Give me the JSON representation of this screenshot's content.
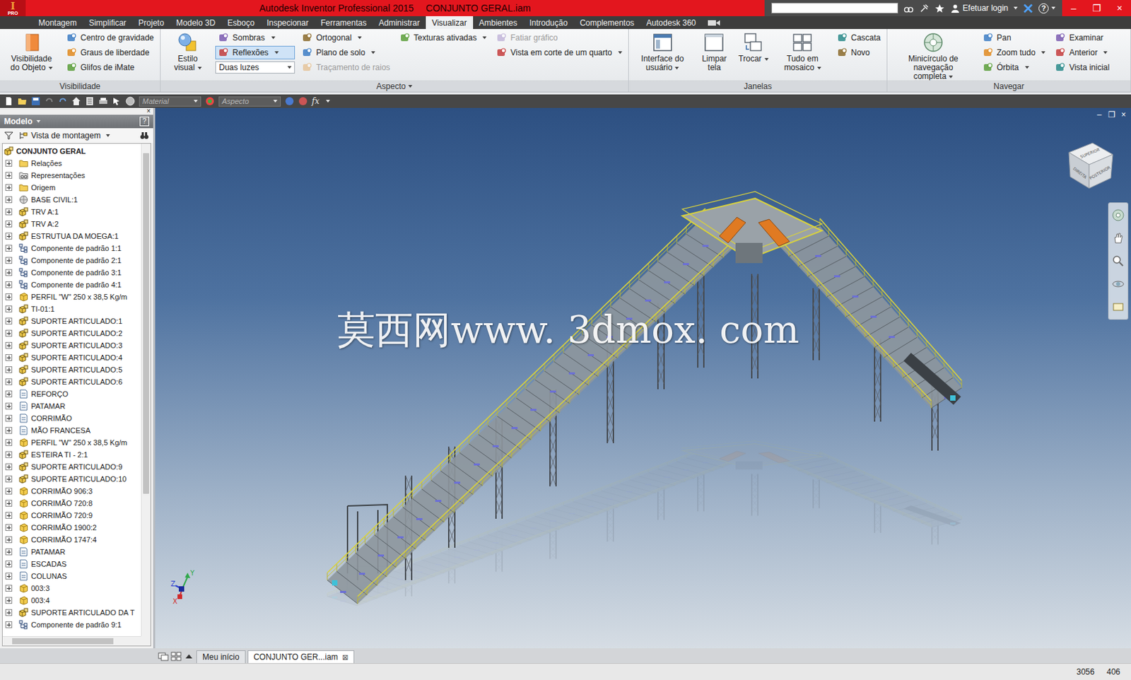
{
  "titlebar": {
    "logo_letter": "I",
    "badge": "PRO",
    "app": "Autodesk Inventor Professional 2015",
    "document": "CONJUNTO GERAL.iam",
    "search": "",
    "login": "Efetuar login",
    "help": "?",
    "controls": [
      "–",
      "❐",
      "×"
    ]
  },
  "tabs": [
    {
      "label": "Montagem",
      "selected": false
    },
    {
      "label": "Simplificar",
      "selected": false
    },
    {
      "label": "Projeto",
      "selected": false
    },
    {
      "label": "Modelo 3D",
      "selected": false
    },
    {
      "label": "Esboço",
      "selected": false
    },
    {
      "label": "Inspecionar",
      "selected": false
    },
    {
      "label": "Ferramentas",
      "selected": false
    },
    {
      "label": "Administrar",
      "selected": false
    },
    {
      "label": "Visualizar",
      "selected": true
    },
    {
      "label": "Ambientes",
      "selected": false
    },
    {
      "label": "Introdução",
      "selected": false
    },
    {
      "label": "Complementos",
      "selected": false
    },
    {
      "label": "Autodesk 360",
      "selected": false
    }
  ],
  "ribbon": {
    "panels": [
      {
        "label": "Visibilidade",
        "dropdown": false,
        "groups": [
          {
            "kind": "big",
            "button": {
              "label": "Visibilidade do Objeto",
              "dropdown": true,
              "selected": false,
              "disabled": false
            }
          },
          {
            "kind": "column",
            "buttons": [
              {
                "label": "Centro de gravidade",
                "kind": "button",
                "dropdown": false,
                "selected": false,
                "disabled": false
              },
              {
                "label": "Graus de liberdade",
                "kind": "button",
                "dropdown": false,
                "selected": false,
                "disabled": false
              },
              {
                "label": "Glifos de iMate",
                "kind": "button",
                "dropdown": false,
                "selected": false,
                "disabled": false
              }
            ]
          }
        ]
      },
      {
        "label": "Aspecto",
        "dropdown": true,
        "groups": [
          {
            "kind": "big",
            "button": {
              "label": "Estilo visual",
              "dropdown": true,
              "selected": false,
              "disabled": false
            }
          },
          {
            "kind": "column",
            "buttons": [
              {
                "label": "Sombras",
                "kind": "button",
                "dropdown": true,
                "selected": false,
                "disabled": false
              },
              {
                "label": "Reflexões",
                "kind": "button",
                "dropdown": true,
                "selected": true,
                "disabled": false
              },
              {
                "label": "Duas luzes",
                "kind": "combo",
                "dropdown": true,
                "selected": false,
                "disabled": false
              }
            ]
          },
          {
            "kind": "column",
            "buttons": [
              {
                "label": "Ortogonal",
                "kind": "button",
                "dropdown": true,
                "selected": false,
                "disabled": false
              },
              {
                "label": "Plano de solo",
                "kind": "button",
                "dropdown": true,
                "selected": false,
                "disabled": false
              },
              {
                "label": "Traçamento de raios",
                "kind": "button",
                "dropdown": false,
                "selected": false,
                "disabled": true
              }
            ]
          },
          {
            "kind": "column",
            "buttons": [
              {
                "label": "Texturas ativadas",
                "kind": "button",
                "dropdown": true,
                "selected": false,
                "disabled": false
              }
            ]
          },
          {
            "kind": "column",
            "buttons": [
              {
                "label": "Fatiar gráfico",
                "kind": "button",
                "dropdown": false,
                "selected": false,
                "disabled": true
              },
              {
                "label": "Vista em corte de um quarto",
                "kind": "button",
                "dropdown": true,
                "selected": false,
                "disabled": false
              }
            ]
          }
        ]
      },
      {
        "label": "Janelas",
        "dropdown": false,
        "groups": [
          {
            "kind": "big",
            "button": {
              "label": "Interface do usuário",
              "dropdown": true,
              "selected": false,
              "disabled": false
            }
          },
          {
            "kind": "big",
            "button": {
              "label": "Limpar tela",
              "dropdown": false,
              "selected": false,
              "disabled": false
            }
          },
          {
            "kind": "big",
            "button": {
              "label": "Trocar",
              "dropdown": true,
              "selected": false,
              "disabled": false
            }
          },
          {
            "kind": "big",
            "button": {
              "label": "Tudo em mosaico",
              "dropdown": true,
              "selected": false,
              "disabled": false
            }
          },
          {
            "kind": "column",
            "buttons": [
              {
                "label": "Cascata",
                "kind": "button",
                "dropdown": false,
                "selected": false,
                "disabled": false
              },
              {
                "label": "Novo",
                "kind": "button",
                "dropdown": false,
                "selected": false,
                "disabled": false
              }
            ]
          }
        ]
      },
      {
        "label": "Navegar",
        "dropdown": false,
        "groups": [
          {
            "kind": "big",
            "button": {
              "label": "Minicírculo de navegação completa",
              "dropdown": true,
              "selected": false,
              "disabled": false
            }
          },
          {
            "kind": "column",
            "buttons": [
              {
                "label": "Pan",
                "kind": "button",
                "dropdown": false,
                "selected": false,
                "disabled": false
              },
              {
                "label": "Zoom tudo",
                "kind": "button",
                "dropdown": true,
                "selected": false,
                "disabled": false
              },
              {
                "label": "Órbita",
                "kind": "button",
                "dropdown": true,
                "selected": false,
                "disabled": false
              }
            ]
          },
          {
            "kind": "column",
            "buttons": [
              {
                "label": "Examinar",
                "kind": "button",
                "dropdown": false,
                "selected": false,
                "disabled": false
              },
              {
                "label": "Anterior",
                "kind": "button",
                "dropdown": true,
                "selected": false,
                "disabled": false
              },
              {
                "label": "Vista inicial",
                "kind": "button",
                "dropdown": false,
                "selected": false,
                "disabled": false
              }
            ]
          }
        ]
      }
    ]
  },
  "quick_access": {
    "material": "Material",
    "appearance": "Aspecto",
    "fx": "fx",
    "disabled": true
  },
  "browser": {
    "title": "Modelo",
    "help": "?",
    "close": "×",
    "view": "Vista de montagem",
    "items": [
      {
        "label": "CONJUNTO GERAL",
        "kind": "root",
        "expanded": true,
        "selected": false
      },
      {
        "label": "Relações",
        "kind": "folder",
        "expanded": false,
        "selected": false
      },
      {
        "label": "Representações",
        "kind": "representations",
        "expanded": false,
        "selected": false
      },
      {
        "label": "Origem",
        "kind": "folder",
        "expanded": false,
        "selected": false
      },
      {
        "label": "BASE CIVIL:1",
        "kind": "civil",
        "expanded": false,
        "selected": false
      },
      {
        "label": "TRV A:1",
        "kind": "assembly",
        "expanded": false,
        "selected": false
      },
      {
        "label": "TRV A:2",
        "kind": "assembly",
        "expanded": false,
        "selected": false
      },
      {
        "label": "ESTRUTUA DA MOEGA:1",
        "kind": "assembly",
        "expanded": false,
        "selected": false
      },
      {
        "label": "Componente de padrão 1:1",
        "kind": "pattern",
        "expanded": false,
        "selected": false
      },
      {
        "label": "Componente de padrão 2:1",
        "kind": "pattern",
        "expanded": false,
        "selected": false
      },
      {
        "label": "Componente de padrão 3:1",
        "kind": "pattern",
        "expanded": false,
        "selected": false
      },
      {
        "label": "Componente de padrão 4:1",
        "kind": "pattern",
        "expanded": false,
        "selected": false
      },
      {
        "label": "PERFIL \"W\" 250 x 38,5 Kg/m",
        "kind": "part",
        "expanded": false,
        "selected": false
      },
      {
        "label": "TI-01:1",
        "kind": "assembly",
        "expanded": false,
        "selected": false
      },
      {
        "label": "SUPORTE ARTICULADO:1",
        "kind": "assembly",
        "expanded": false,
        "selected": false
      },
      {
        "label": "SUPORTE ARTICULADO:2",
        "kind": "assembly",
        "expanded": false,
        "selected": false
      },
      {
        "label": "SUPORTE ARTICULADO:3",
        "kind": "assembly",
        "expanded": false,
        "selected": false
      },
      {
        "label": "SUPORTE ARTICULADO:4",
        "kind": "assembly",
        "expanded": false,
        "selected": false
      },
      {
        "label": "SUPORTE ARTICULADO:5",
        "kind": "assembly",
        "expanded": false,
        "selected": false
      },
      {
        "label": "SUPORTE ARTICULADO:6",
        "kind": "assembly",
        "expanded": false,
        "selected": false
      },
      {
        "label": "REFORÇO",
        "kind": "group",
        "expanded": false,
        "selected": false
      },
      {
        "label": "PATAMAR",
        "kind": "group",
        "expanded": false,
        "selected": false
      },
      {
        "label": "CORRIMÃO",
        "kind": "group",
        "expanded": false,
        "selected": false
      },
      {
        "label": "MÃO FRANCESA",
        "kind": "group",
        "expanded": false,
        "selected": false
      },
      {
        "label": "PERFIL \"W\" 250 x 38,5 Kg/m",
        "kind": "part",
        "expanded": false,
        "selected": false
      },
      {
        "label": "ESTEIRA TI - 2:1",
        "kind": "assembly",
        "expanded": false,
        "selected": false
      },
      {
        "label": "SUPORTE ARTICULADO:9",
        "kind": "assembly",
        "expanded": false,
        "selected": false
      },
      {
        "label": "SUPORTE ARTICULADO:10",
        "kind": "assembly",
        "expanded": false,
        "selected": false
      },
      {
        "label": "CORRIMÃO 906:3",
        "kind": "part",
        "expanded": false,
        "selected": false
      },
      {
        "label": "CORRIMÃO 720:8",
        "kind": "part",
        "expanded": false,
        "selected": false
      },
      {
        "label": "CORRIMÃO 720:9",
        "kind": "part",
        "expanded": false,
        "selected": false
      },
      {
        "label": "CORRIMÃO 1900:2",
        "kind": "part",
        "expanded": false,
        "selected": false
      },
      {
        "label": "CORRIMÃO 1747:4",
        "kind": "part",
        "expanded": false,
        "selected": false
      },
      {
        "label": "PATAMAR",
        "kind": "group",
        "expanded": false,
        "selected": false
      },
      {
        "label": "ESCADAS",
        "kind": "group",
        "expanded": false,
        "selected": false
      },
      {
        "label": "COLUNAS",
        "kind": "group",
        "expanded": false,
        "selected": false
      },
      {
        "label": "003:3",
        "kind": "part",
        "expanded": false,
        "selected": false
      },
      {
        "label": "003:4",
        "kind": "part",
        "expanded": false,
        "selected": false
      },
      {
        "label": "SUPORTE ARTICULADO DA T",
        "kind": "assembly",
        "expanded": false,
        "selected": false
      },
      {
        "label": "Componente de padrão 9:1",
        "kind": "pattern",
        "expanded": false,
        "selected": false
      }
    ]
  },
  "viewport": {
    "watermark": "莫西网www. 3dmox. com",
    "viewcube": [
      "SUPERIOR",
      "DIREITA",
      "POSTERIOR"
    ],
    "axes": [
      "X",
      "Y",
      "Z"
    ],
    "controls": [
      "–",
      "❐",
      "×"
    ]
  },
  "doc_tabs": [
    {
      "label": "Meu início",
      "selected": false,
      "closable": false
    },
    {
      "label": "CONJUNTO GER...iam",
      "selected": true,
      "closable": true
    }
  ],
  "doc_tab_close": "⊠",
  "status_bar": [
    "3056",
    "406"
  ]
}
